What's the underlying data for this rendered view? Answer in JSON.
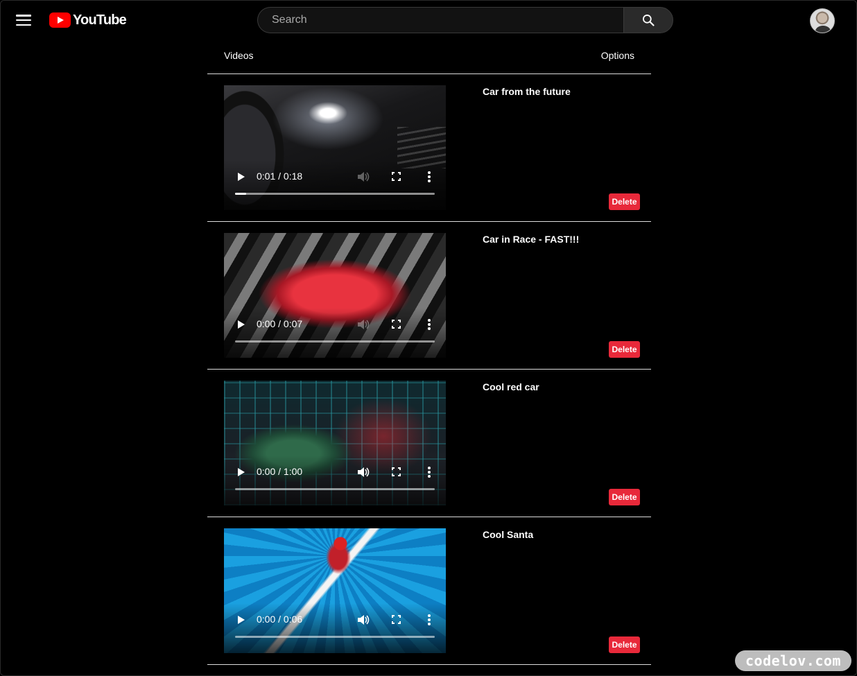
{
  "header": {
    "logo_text": "YouTube",
    "search_placeholder": "Search",
    "search_value": ""
  },
  "table": {
    "col_videos": "Videos",
    "col_options": "Options"
  },
  "videos": [
    {
      "title": "Car from the future",
      "time": "0:01 / 0:18",
      "progress": 0.055,
      "delete_label": "Delete"
    },
    {
      "title": "Car in Race - FAST!!!",
      "time": "0:00 / 0:07",
      "progress": 0,
      "delete_label": "Delete"
    },
    {
      "title": "Cool red car",
      "time": "0:00 / 1:00",
      "progress": 0,
      "delete_label": "Delete"
    },
    {
      "title": "Cool Santa",
      "time": "0:00 / 0:06",
      "progress": 0,
      "delete_label": "Delete"
    }
  ],
  "watermark": "codelov.com",
  "colors": {
    "brand_red": "#ff0000",
    "delete_red": "#e8293a",
    "background": "#000000"
  },
  "icons": [
    "menu-icon",
    "youtube-logo-icon",
    "search-icon",
    "play-icon",
    "volume-icon",
    "fullscreen-icon",
    "more-vert-icon"
  ]
}
